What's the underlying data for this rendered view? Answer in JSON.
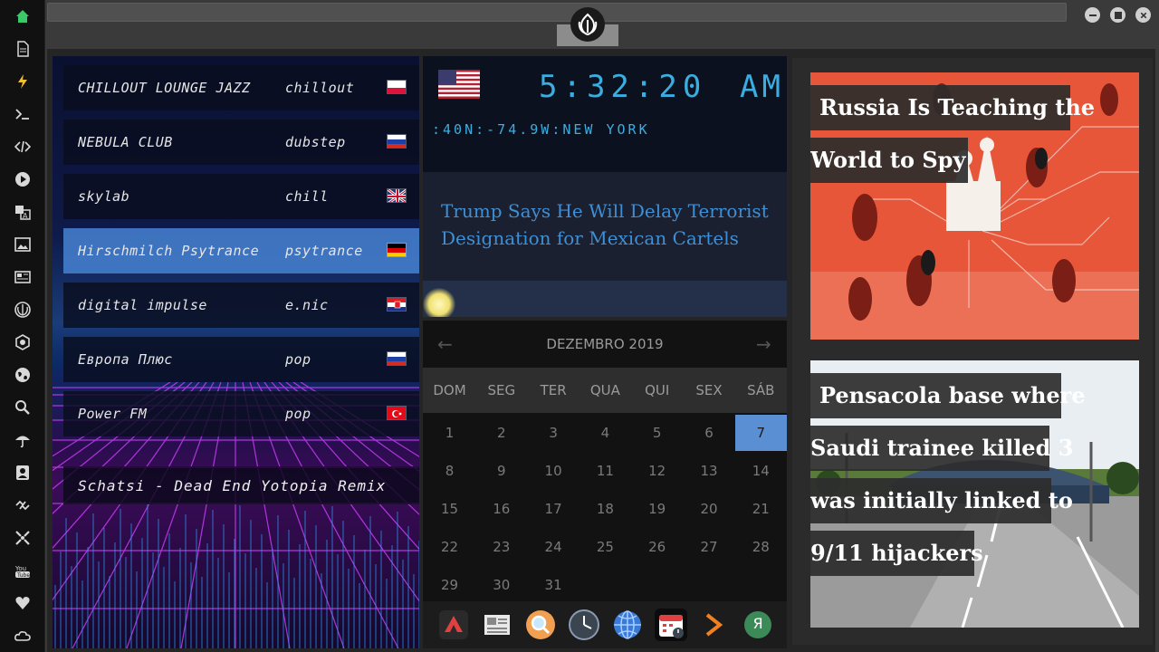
{
  "window": {
    "minimize_label": "minimize",
    "maximize_label": "maximize",
    "close_label": "close"
  },
  "sidebar": {
    "items": [
      {
        "icon": "home-icon"
      },
      {
        "icon": "document-icon"
      },
      {
        "icon": "bolt-icon"
      },
      {
        "icon": "terminal-icon"
      },
      {
        "icon": "code-icon"
      },
      {
        "icon": "play-icon"
      },
      {
        "icon": "translate-icon"
      },
      {
        "icon": "image-icon"
      },
      {
        "icon": "news-icon"
      },
      {
        "icon": "rebel-icon"
      },
      {
        "icon": "empire-icon"
      },
      {
        "icon": "globe-icon"
      },
      {
        "icon": "search-icon"
      },
      {
        "icon": "umbrella-icon"
      },
      {
        "icon": "contact-icon"
      },
      {
        "icon": "link-icon"
      },
      {
        "icon": "expand-icon"
      },
      {
        "icon": "youtube-icon"
      },
      {
        "icon": "heart-icon"
      },
      {
        "icon": "cloud-icon"
      }
    ]
  },
  "radio": {
    "stations": [
      {
        "name": "CHILLOUT LOUNGE JAZZ",
        "genre": "chillout",
        "flag": "poland"
      },
      {
        "name": "NEBULA CLUB",
        "genre": "dubstep",
        "flag": "russia"
      },
      {
        "name": "skylab",
        "genre": "chill",
        "flag": "uk"
      },
      {
        "name": "Hirschmilch Psytrance",
        "genre": "psytrance",
        "flag": "germany"
      },
      {
        "name": "digital impulse",
        "genre": "e.nic",
        "flag": "croatia"
      },
      {
        "name": "Европа Плюс",
        "genre": "pop",
        "flag": "russia"
      },
      {
        "name": "Power FM",
        "genre": "pop",
        "flag": "turkey"
      }
    ],
    "active_index": 3,
    "now_playing": "Schatsi - Dead End Yotopia Remix"
  },
  "clock": {
    "time": "5:32:20",
    "ampm": "AM",
    "location": ":40N:-74.9W:NEW YORK",
    "flag": "usa"
  },
  "headline": {
    "text": "Trump Says He Will Delay Terrorist Designation for Mexican Cartels"
  },
  "calendar": {
    "month": "DEZEMBRO 2019",
    "prev": "←",
    "next": "→",
    "daynames": [
      "DOM",
      "SEG",
      "TER",
      "QUA",
      "QUI",
      "SEX",
      "SÁB"
    ],
    "days": [
      "1",
      "2",
      "3",
      "4",
      "5",
      "6",
      "7",
      "8",
      "9",
      "10",
      "11",
      "12",
      "13",
      "14",
      "15",
      "16",
      "17",
      "18",
      "19",
      "20",
      "21",
      "22",
      "23",
      "24",
      "25",
      "26",
      "27",
      "28",
      "29",
      "30",
      "31"
    ],
    "today": "7"
  },
  "dock": {
    "items": [
      {
        "icon": "arrow-up-icon",
        "selected": false
      },
      {
        "icon": "newspaper-icon",
        "selected": false
      },
      {
        "icon": "magnifier-icon",
        "selected": false
      },
      {
        "icon": "clock-icon",
        "selected": false
      },
      {
        "icon": "globe-icon",
        "selected": false
      },
      {
        "icon": "calendar-icon",
        "selected": true
      },
      {
        "icon": "terminal-arrow-icon",
        "selected": false
      },
      {
        "icon": "yandex-icon",
        "selected": false
      }
    ],
    "yandex_letter": "Я"
  },
  "news": [
    {
      "lines": [
        "Russia Is Teaching the",
        "World to Spy"
      ]
    },
    {
      "lines": [
        "Pensacola base where",
        "Saudi trainee killed 3",
        "was initially linked to",
        "9/11 hijackers"
      ]
    }
  ],
  "colors": {
    "accent": "#3aaee0",
    "calendar_today": "#5b8fd4",
    "radio_active": "#4682d2"
  }
}
